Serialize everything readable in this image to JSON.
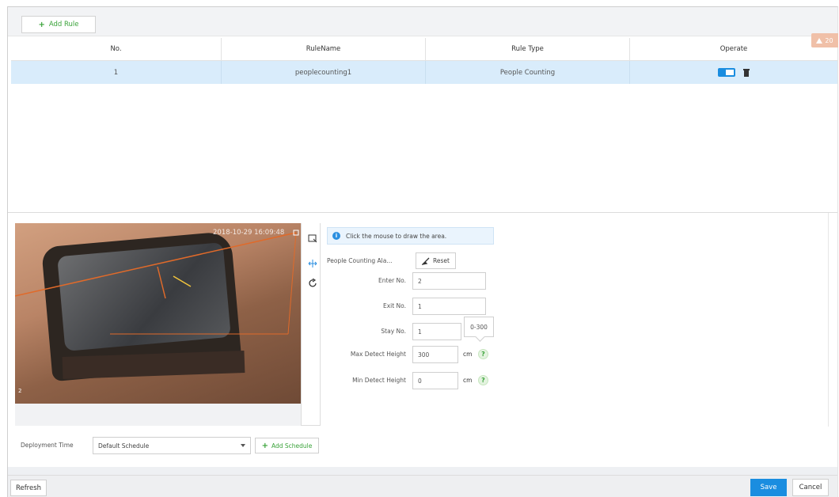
{
  "toolbar": {
    "add_rule_label": "Add Rule",
    "warning_count": "20"
  },
  "table": {
    "headers": [
      "No.",
      "RuleName",
      "Rule Type",
      "Operate"
    ],
    "rows": [
      {
        "no": "1",
        "rule_name": "peoplecounting1",
        "rule_type": "People Counting",
        "enabled": true
      }
    ]
  },
  "video": {
    "timestamp": "2018-10-29 16:09:48",
    "channel_label": "2"
  },
  "config": {
    "info_text": "Click the mouse to draw the area.",
    "area_label": "People Counting Ala...",
    "reset_label": "Reset",
    "enter_label": "Enter No.",
    "enter_value": "2",
    "exit_label": "Exit No.",
    "exit_value": "1",
    "stay_label": "Stay No.",
    "stay_value": "1",
    "max_label": "Max Detect Height",
    "max_value": "300",
    "min_label": "Min Detect Height",
    "min_value": "0",
    "unit": "cm",
    "tooltip": "0-300",
    "help_symbol": "?"
  },
  "deployment": {
    "label": "Deployment Time",
    "schedule_value": "Default Schedule",
    "add_schedule_label": "Add Schedule"
  },
  "footer": {
    "refresh_label": "Refresh",
    "save_label": "Save",
    "cancel_label": "Cancel"
  }
}
